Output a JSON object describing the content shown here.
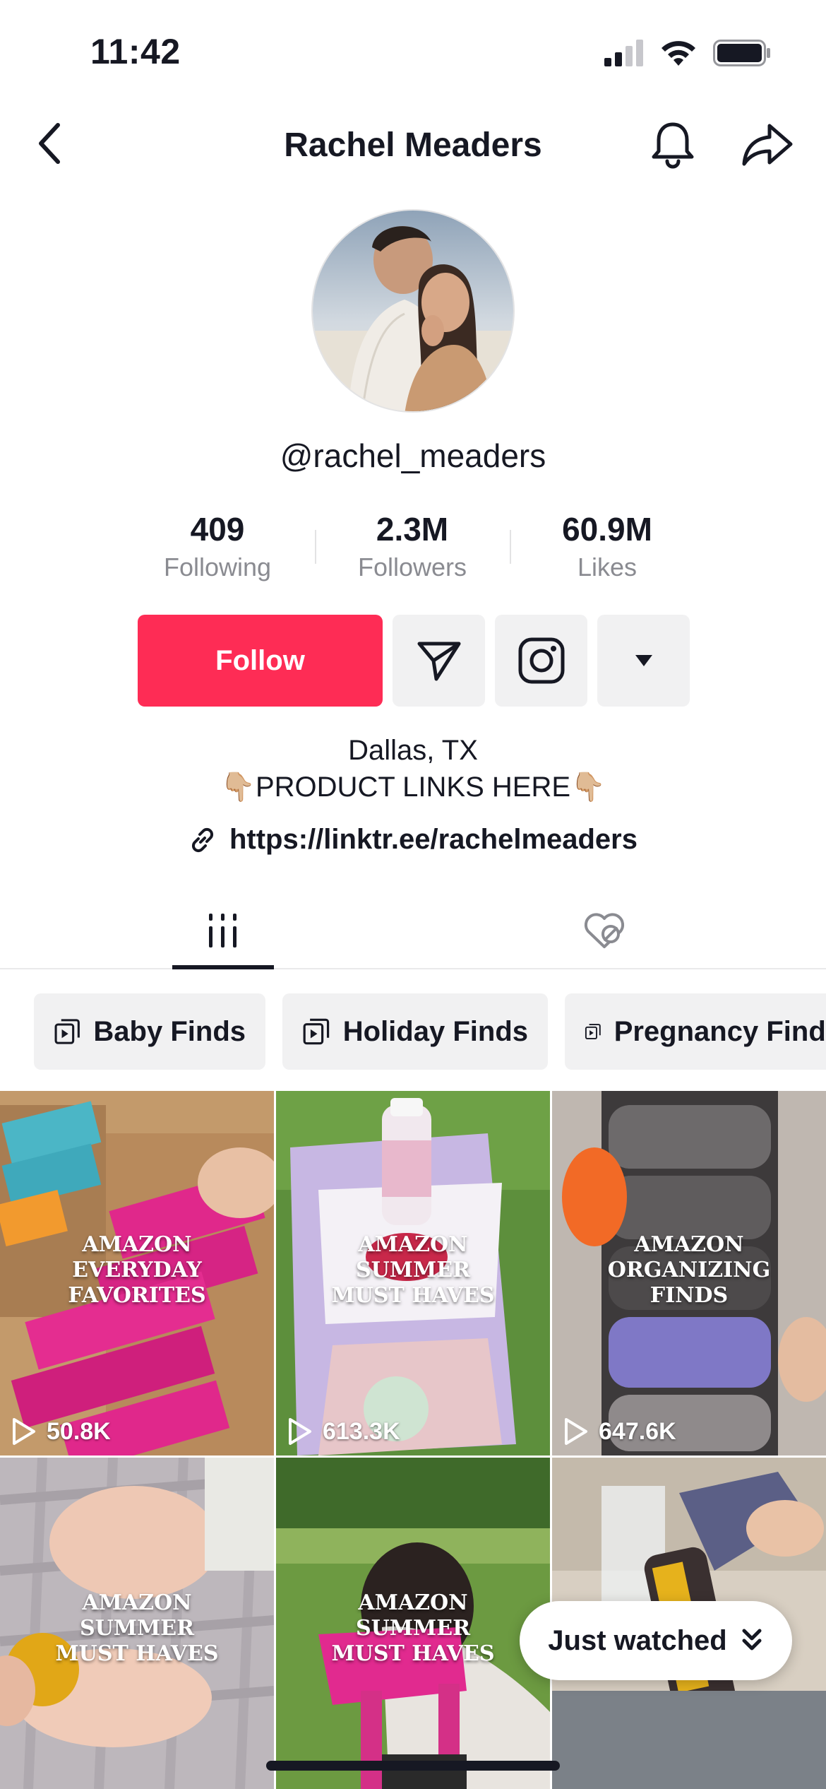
{
  "status_bar": {
    "time": "11:42"
  },
  "nav": {
    "title": "Rachel Meaders"
  },
  "profile": {
    "handle": "@rachel_meaders",
    "stats": [
      {
        "value": "409",
        "label": "Following"
      },
      {
        "value": "2.3M",
        "label": "Followers"
      },
      {
        "value": "60.9M",
        "label": "Likes"
      }
    ],
    "follow_label": "Follow",
    "bio_lines": [
      "Dallas, TX",
      "👇🏼PRODUCT LINKS HERE👇🏼"
    ],
    "link": "https://linktr.ee/rachelmeaders"
  },
  "tabs": [
    {
      "name": "videos",
      "icon": "grid-bars-icon",
      "active": true
    },
    {
      "name": "liked",
      "icon": "hidden-heart-icon",
      "active": false
    }
  ],
  "playlists": [
    {
      "label": "Baby Finds"
    },
    {
      "label": "Holiday Finds"
    },
    {
      "label": "Pregnancy Finds"
    }
  ],
  "videos": [
    {
      "caption": "AMAZON EVERYDAY FAVORITES",
      "views": "50.8K"
    },
    {
      "caption": "AMAZON SUMMER MUST HAVES",
      "views": "613.3K"
    },
    {
      "caption": "AMAZON ORGANIZING FINDS",
      "views": "647.6K"
    },
    {
      "caption": "AMAZON SUMMER MUST HAVES",
      "views": ""
    },
    {
      "caption": "AMAZON SUMMER MUST HAVES",
      "views": ""
    },
    {
      "caption": "",
      "views": ""
    }
  ],
  "just_watched_label": "Just watched",
  "colors": {
    "accent": "#fe2c55",
    "text": "#161823",
    "muted": "#8a8b91",
    "chip_bg": "#f1f1f2"
  }
}
